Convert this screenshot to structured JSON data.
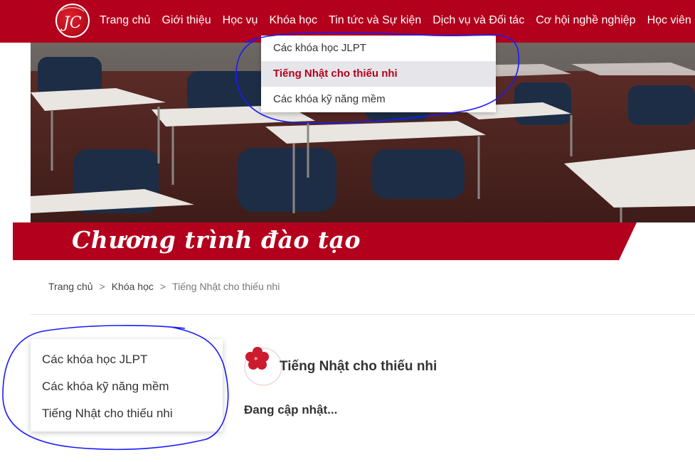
{
  "header": {
    "logo_text": "JC",
    "nav": [
      {
        "label": "Trang chủ"
      },
      {
        "label": "Giới thiệu"
      },
      {
        "label": "Học vụ"
      },
      {
        "label": "Khóa học"
      },
      {
        "label": "Tin tức và Sự kiện"
      },
      {
        "label": "Dịch vụ và Đối tác"
      },
      {
        "label": "Cơ hội nghề nghiệp"
      },
      {
        "label": "Học viên"
      }
    ],
    "dropdown": [
      {
        "label": "Các khóa học JLPT"
      },
      {
        "label": "Tiếng Nhật cho thiếu nhi",
        "active": true
      },
      {
        "label": "Các khóa kỹ năng mềm"
      }
    ]
  },
  "banner": {
    "title": "Chương trình đào tạo"
  },
  "breadcrumb": {
    "items": [
      {
        "label": "Trang chủ"
      },
      {
        "label": "Khóa học"
      },
      {
        "label": "Tiếng Nhật cho thiếu nhi"
      }
    ],
    "separator": ">"
  },
  "sidebar": {
    "items": [
      {
        "label": "Các khóa học JLPT"
      },
      {
        "label": "Các khóa kỹ năng mềm"
      },
      {
        "label": "Tiếng Nhật cho thiếu nhi"
      }
    ]
  },
  "content": {
    "icon": "sakura-flower-icon",
    "title": "Tiếng Nhật cho thiếu nhi",
    "body": "Đang cập nhật..."
  },
  "colors": {
    "brand": "#b3001c",
    "dropdown_active_bg": "#e6e6ea",
    "annotation": "#1a1aff"
  }
}
